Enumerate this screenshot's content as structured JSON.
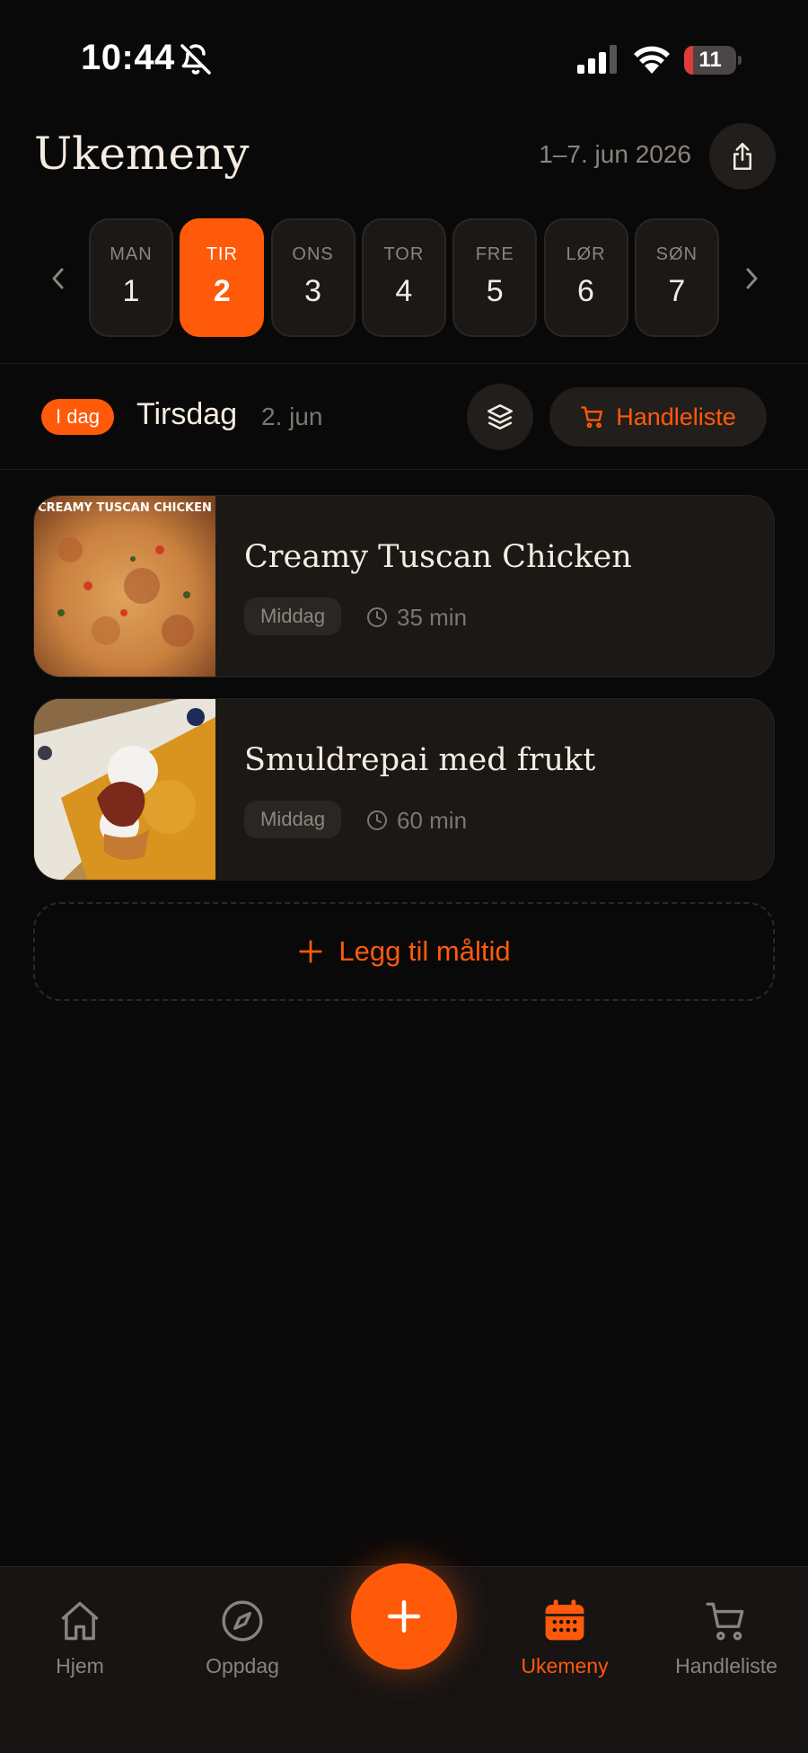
{
  "status_bar": {
    "time": "10:44",
    "battery": "11",
    "battery_level": 0.11,
    "icons": [
      "bell-slash-icon",
      "signal-icon",
      "wifi-icon",
      "battery-icon"
    ]
  },
  "header": {
    "title": "Ukemeny",
    "date_range": "1–7. jun 2026",
    "share_icon": "share-icon"
  },
  "week": {
    "prev_icon": "chevron-left-icon",
    "next_icon": "chevron-right-icon",
    "days": [
      {
        "name": "MAN",
        "num": "1"
      },
      {
        "name": "TIR",
        "num": "2",
        "active": true
      },
      {
        "name": "ONS",
        "num": "3"
      },
      {
        "name": "TOR",
        "num": "4"
      },
      {
        "name": "FRE",
        "num": "5"
      },
      {
        "name": "LØR",
        "num": "6"
      },
      {
        "name": "SØN",
        "num": "7"
      }
    ]
  },
  "day_header": {
    "badge": "I dag",
    "day_name": "Tirsdag",
    "date": "2. jun",
    "layers_icon": "layers-icon",
    "shopping_button": "Handleliste"
  },
  "meals": [
    {
      "name": "Creamy Tuscan Chicken",
      "tag": "Middag",
      "duration": "35 min",
      "thumb_caption": "CREAMY TUSCAN CHICKEN"
    },
    {
      "name": "Smuldrepai med frukt",
      "tag": "Middag",
      "duration": "60 min"
    }
  ],
  "add_meal": "Legg til måltid",
  "tabs": [
    {
      "label": "Hjem",
      "icon": "home-icon"
    },
    {
      "label": "Oppdag",
      "icon": "compass-icon"
    },
    {
      "label": "Ukemeny",
      "icon": "calendar-icon",
      "active": true
    },
    {
      "label": "Handleliste",
      "icon": "cart-icon"
    }
  ],
  "fab_icon": "plus-icon",
  "colors": {
    "accent": "#ff5a0a",
    "background": "#0a0909",
    "card": "#1b1816",
    "text": "#f4ece0",
    "muted": "#8a847d"
  }
}
